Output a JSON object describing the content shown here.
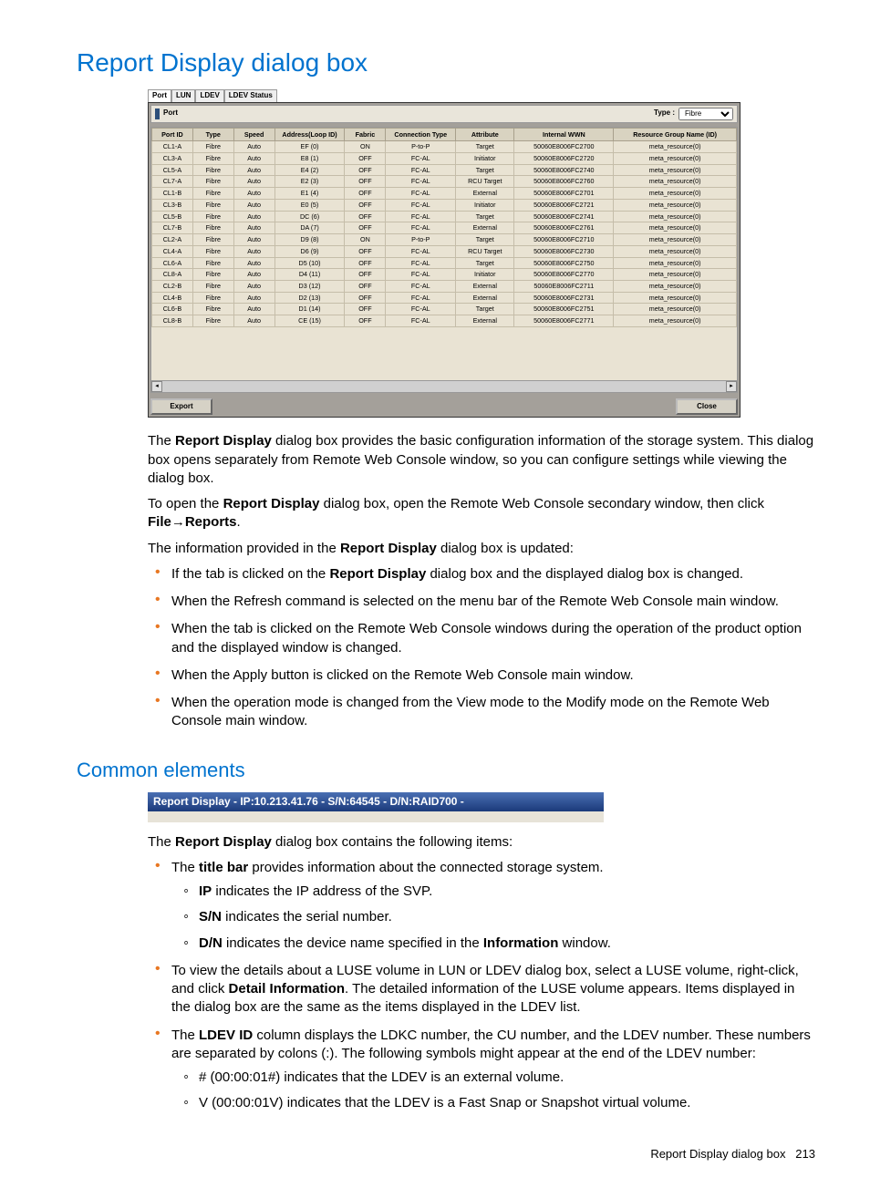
{
  "title": "Report Display dialog box",
  "dialog": {
    "tabs": [
      "Port",
      "LUN",
      "LDEV",
      "LDEV Status"
    ],
    "panel_label": "Port",
    "type_label": "Type :",
    "type_options": [
      "Fibre"
    ],
    "headers": [
      "Port ID",
      "Type",
      "Speed",
      "Address(Loop ID)",
      "Fabric",
      "Connection Type",
      "Attribute",
      "Internal WWN",
      "Resource Group Name (ID)"
    ],
    "rows": [
      [
        "CL1-A",
        "Fibre",
        "Auto",
        "EF (0)",
        "ON",
        "P-to-P",
        "Target",
        "50060E8006FC2700",
        "meta_resource(0)"
      ],
      [
        "CL3-A",
        "Fibre",
        "Auto",
        "E8 (1)",
        "OFF",
        "FC-AL",
        "Initiator",
        "50060E8006FC2720",
        "meta_resource(0)"
      ],
      [
        "CL5-A",
        "Fibre",
        "Auto",
        "E4 (2)",
        "OFF",
        "FC-AL",
        "Target",
        "50060E8006FC2740",
        "meta_resource(0)"
      ],
      [
        "CL7-A",
        "Fibre",
        "Auto",
        "E2 (3)",
        "OFF",
        "FC-AL",
        "RCU Target",
        "50060E8006FC2760",
        "meta_resource(0)"
      ],
      [
        "CL1-B",
        "Fibre",
        "Auto",
        "E1 (4)",
        "OFF",
        "FC-AL",
        "External",
        "50060E8006FC2701",
        "meta_resource(0)"
      ],
      [
        "CL3-B",
        "Fibre",
        "Auto",
        "E0 (5)",
        "OFF",
        "FC-AL",
        "Initiator",
        "50060E8006FC2721",
        "meta_resource(0)"
      ],
      [
        "CL5-B",
        "Fibre",
        "Auto",
        "DC (6)",
        "OFF",
        "FC-AL",
        "Target",
        "50060E8006FC2741",
        "meta_resource(0)"
      ],
      [
        "CL7-B",
        "Fibre",
        "Auto",
        "DA (7)",
        "OFF",
        "FC-AL",
        "External",
        "50060E8006FC2761",
        "meta_resource(0)"
      ],
      [
        "CL2-A",
        "Fibre",
        "Auto",
        "D9 (8)",
        "ON",
        "P-to-P",
        "Target",
        "50060E8006FC2710",
        "meta_resource(0)"
      ],
      [
        "CL4-A",
        "Fibre",
        "Auto",
        "D6 (9)",
        "OFF",
        "FC-AL",
        "RCU Target",
        "50060E8006FC2730",
        "meta_resource(0)"
      ],
      [
        "CL6-A",
        "Fibre",
        "Auto",
        "D5 (10)",
        "OFF",
        "FC-AL",
        "Target",
        "50060E8006FC2750",
        "meta_resource(0)"
      ],
      [
        "CL8-A",
        "Fibre",
        "Auto",
        "D4 (11)",
        "OFF",
        "FC-AL",
        "Initiator",
        "50060E8006FC2770",
        "meta_resource(0)"
      ],
      [
        "CL2-B",
        "Fibre",
        "Auto",
        "D3 (12)",
        "OFF",
        "FC-AL",
        "External",
        "50060E8006FC2711",
        "meta_resource(0)"
      ],
      [
        "CL4-B",
        "Fibre",
        "Auto",
        "D2 (13)",
        "OFF",
        "FC-AL",
        "External",
        "50060E8006FC2731",
        "meta_resource(0)"
      ],
      [
        "CL6-B",
        "Fibre",
        "Auto",
        "D1 (14)",
        "OFF",
        "FC-AL",
        "Target",
        "50060E8006FC2751",
        "meta_resource(0)"
      ],
      [
        "CL8-B",
        "Fibre",
        "Auto",
        "CE (15)",
        "OFF",
        "FC-AL",
        "External",
        "50060E8006FC2771",
        "meta_resource(0)"
      ]
    ],
    "export_label": "Export",
    "close_label": "Close"
  },
  "body": {
    "p1a": "The ",
    "p1b": "Report Display",
    "p1c": " dialog box provides the basic configuration information of the storage system. This dialog box opens separately from Remote Web Console window, so you can configure settings while viewing the dialog box.",
    "p2a": "To open the ",
    "p2b": "Report Display",
    "p2c": " dialog box, open the Remote Web Console secondary window, then click ",
    "p2d": "File",
    "p2e": "→",
    "p2f": "Reports",
    "p2g": ".",
    "p3a": "The information provided in the ",
    "p3b": "Report Display",
    "p3c": " dialog box is updated:",
    "bullets1": [
      "If the tab is clicked on the <b>Report Display</b> dialog box and the displayed dialog box is changed.",
      "When the Refresh command is selected on the menu bar of the Remote Web Console main window.",
      "When the tab is clicked on the Remote Web Console windows during the operation of the product option and the displayed window is changed.",
      "When the Apply button is clicked on the Remote Web Console main window.",
      "When the operation mode is changed from the View mode to the Modify mode on the Remote Web Console main window."
    ]
  },
  "common": {
    "title": "Common elements",
    "titlebar_text": "Report Display - IP:10.213.41.76 - S/N:64545 - D/N:RAID700 -",
    "p1a": "The ",
    "p1b": "Report Display",
    "p1c": " dialog box contains the following items:",
    "li_title_a": "The ",
    "li_title_b": "title bar",
    "li_title_c": " provides information about the connected storage system.",
    "sub1_ip": "<b>IP</b> indicates the IP address of the SVP.",
    "sub1_sn": "<b>S/N</b> indicates the serial number.",
    "sub1_dn": "<b>D/N</b> indicates the device name specified in the <b>Information</b> window.",
    "li_luse": "To view the details about a LUSE volume in LUN or LDEV dialog box, select a LUSE volume, right-click, and click <b>Detail Information</b>. The detailed information of the LUSE volume appears. Items displayed in the dialog box are the same as the items displayed in the LDEV list.",
    "li_ldev": "The <b>LDEV ID</b> column displays the LDKC number, the CU number, and the LDEV number. These numbers are separated by colons (:). The following symbols might appear at the end of the LDEV number:",
    "sub2_hash": "# (00:00:01#) indicates that the LDEV is an external volume.",
    "sub2_v": "V (00:00:01V) indicates that the LDEV is a Fast Snap or Snapshot virtual volume."
  },
  "footer": {
    "label": "Report Display dialog box",
    "page": "213"
  }
}
